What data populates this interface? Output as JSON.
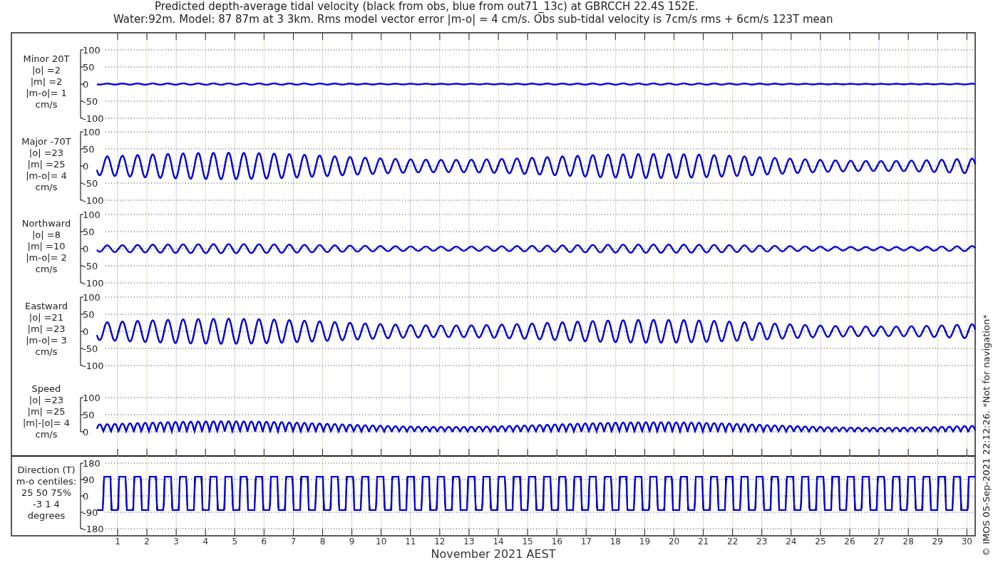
{
  "title": {
    "lines": [
      "Predicted depth-average tidal velocity (black from obs, blue from out71_13c) at GBRCCH 22.4S 152E.",
      "Water:92m. Model: 87 87m at 3 3km. Rms model vector error |m-o| = 4 cm/s. Obs sub-tidal velocity is 7cm/s rms + 6cm/s 123T mean"
    ]
  },
  "panels": [
    {
      "kind": "signed",
      "label_lines": [
        "Minor 20T",
        "|o| =2",
        "|m| =2",
        "|m-o|= 1",
        "cm/s"
      ],
      "yticks": [
        "100",
        "50",
        "0",
        "-50",
        "-100"
      ]
    },
    {
      "kind": "signed",
      "label_lines": [
        "Major -70T",
        "|o| =23",
        "|m| =25",
        "|m-o|= 4",
        "cm/s"
      ],
      "yticks": [
        "100",
        "50",
        "0",
        "-50",
        "-100"
      ]
    },
    {
      "kind": "signed",
      "label_lines": [
        "Northward",
        "|o| =8",
        "|m| =10",
        "|m-o|= 2",
        "cm/s"
      ],
      "yticks": [
        "100",
        "50",
        "0",
        "-50",
        "-100"
      ]
    },
    {
      "kind": "signed",
      "label_lines": [
        "Eastward",
        "|o| =21",
        "|m| =23",
        "|m-o|= 3",
        "cm/s"
      ],
      "yticks": [
        "100",
        "50",
        "0",
        "-50",
        "-100"
      ]
    },
    {
      "kind": "speed",
      "label_lines": [
        "Speed",
        "|o| =23",
        "|m| =25",
        "|m|-|o|= 4",
        "cm/s"
      ],
      "yticks": [
        "100",
        "50",
        "0"
      ]
    },
    {
      "kind": "direction",
      "label_lines": [
        "Direction (T)",
        "m-o centiles:",
        "25  50  75%",
        "-3  1  4",
        "degrees"
      ],
      "yticks": [
        "180",
        "90",
        "0",
        "-90",
        "-180"
      ]
    }
  ],
  "x_axis": {
    "days": [
      "1",
      "2",
      "3",
      "4",
      "5",
      "6",
      "7",
      "8",
      "9",
      "10",
      "11",
      "12",
      "13",
      "14",
      "15",
      "16",
      "17",
      "18",
      "19",
      "20",
      "21",
      "22",
      "23",
      "24",
      "25",
      "26",
      "27",
      "28",
      "29",
      "30"
    ],
    "label": "November 2021 AEST"
  },
  "credit": "© IMOS 05-Sep-2021 22:12:26. *Not for navigation*"
}
